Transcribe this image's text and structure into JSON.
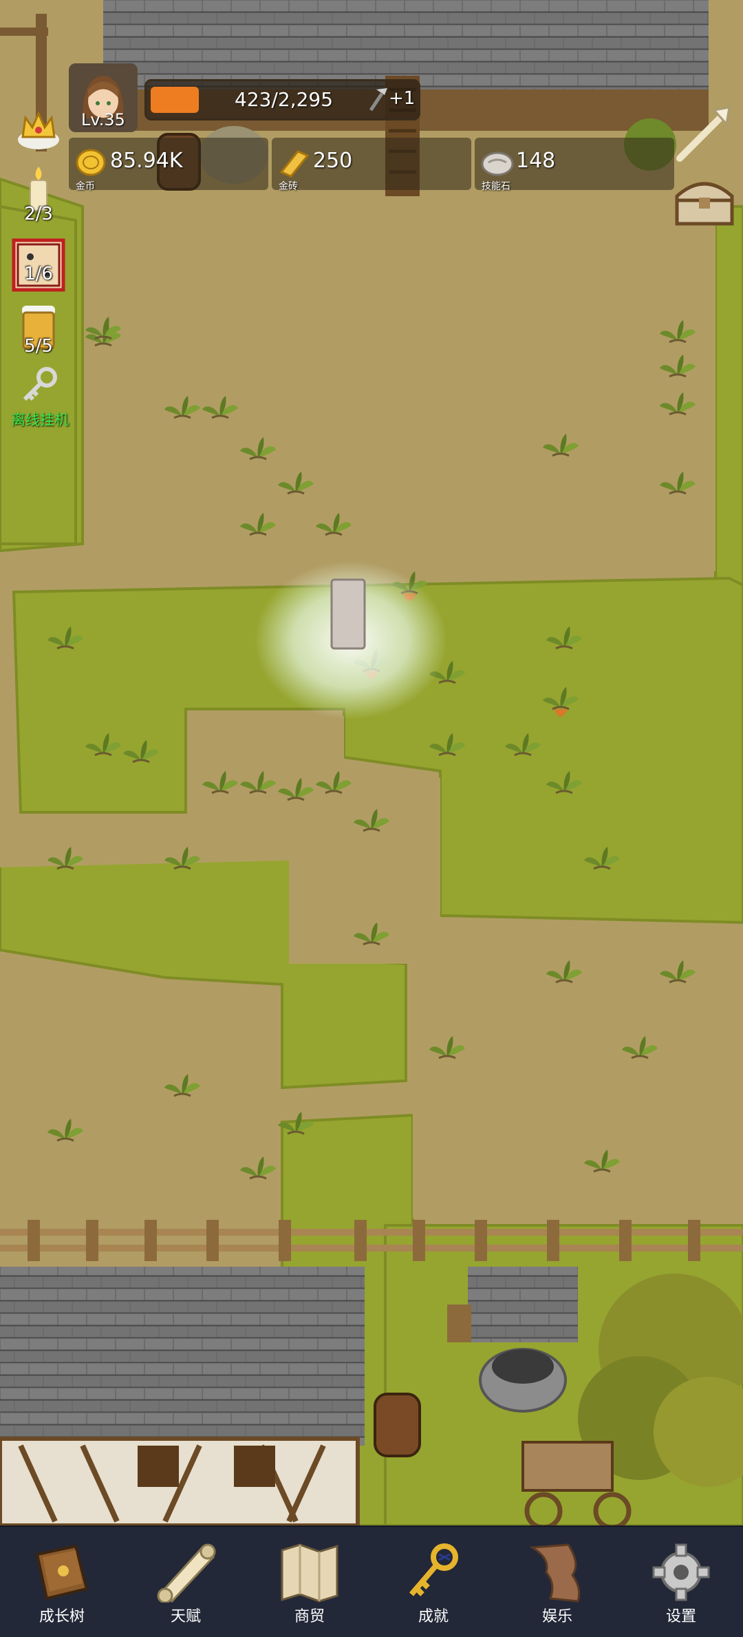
{
  "player": {
    "level": "Lv.35",
    "xp_text": "423/2,295",
    "xp_progress": 0.184,
    "xp_bonus": "+1"
  },
  "resources": [
    {
      "value": "85.94K",
      "label": "金币",
      "icon": "gold-coin-icon"
    },
    {
      "value": "250",
      "label": "金砖",
      "icon": "gold-bar-icon"
    },
    {
      "value": "148",
      "label": "技能石",
      "icon": "skill-stone-icon"
    }
  ],
  "side_items": {
    "crown": {
      "icon": "crown-icon"
    },
    "candle": {
      "icon": "candle-icon",
      "count": "2/3"
    },
    "dice": {
      "icon": "dice-icon",
      "count": "1/6"
    },
    "beer": {
      "icon": "beer-icon",
      "count": "5/5"
    },
    "idle": {
      "icon": "key-icon",
      "label": "离线挂机"
    }
  },
  "top_right": {
    "tools_icon": "bone-tool-icon",
    "chest_icon": "treasure-chest-icon"
  },
  "nav": [
    {
      "label": "成长树",
      "icon": "book-icon"
    },
    {
      "label": "天赋",
      "icon": "scroll-icon"
    },
    {
      "label": "商贸",
      "icon": "map-icon"
    },
    {
      "label": "成就",
      "icon": "golden-key-icon"
    },
    {
      "label": "娱乐",
      "icon": "parchment-icon"
    },
    {
      "label": "设置",
      "icon": "gear-icon"
    }
  ],
  "colors": {
    "dirt": "#b19d63",
    "grass": "#96a52f",
    "roof": "#6e6e6e",
    "nav_bg": "#232838",
    "xp_fill": "#ee7d22",
    "idle_text": "#37e84a"
  }
}
